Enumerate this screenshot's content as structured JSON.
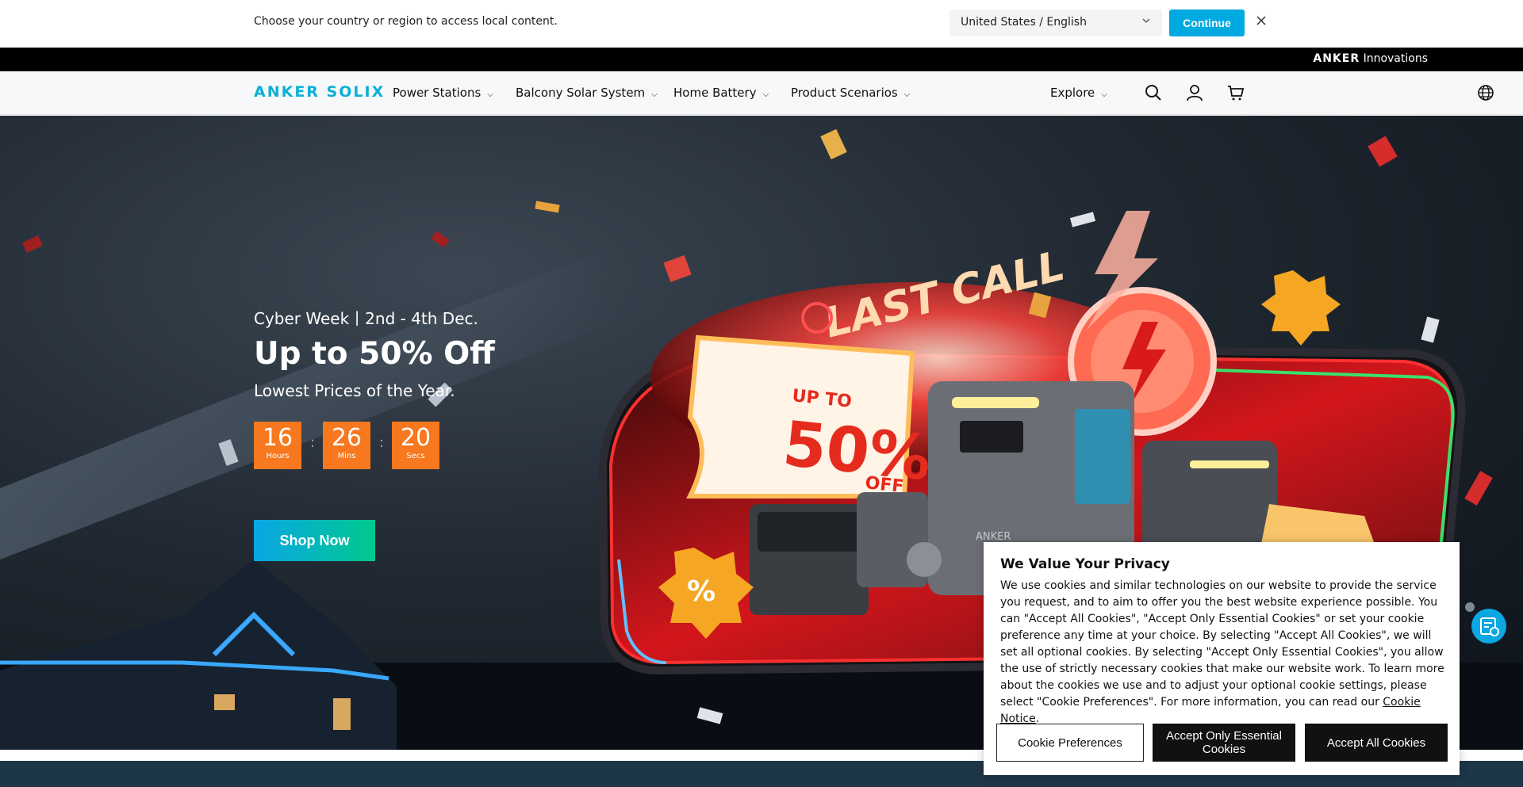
{
  "region_bar": {
    "message": "Choose your country or region to access local content.",
    "selected_region": "United States / English",
    "continue_label": "Continue",
    "close_icon": "close-icon"
  },
  "top_strip": {
    "brand_bold": "ANKER",
    "brand_rest": " Innovations"
  },
  "nav": {
    "logo": "ANKER SOLIX",
    "items": [
      {
        "label": "Power Stations"
      },
      {
        "label": "Balcony Solar System"
      },
      {
        "label": "Home Battery"
      },
      {
        "label": "Product Scenarios"
      }
    ],
    "explore_label": "Explore",
    "icons": [
      "search-icon",
      "user-icon",
      "cart-icon",
      "globe-icon"
    ]
  },
  "hero": {
    "subtitle": "Cyber Week丨2nd - 4th Dec.",
    "title": "Up to 50% Off",
    "description": "Lowest Prices of the Year.",
    "countdown": [
      {
        "value": "16",
        "label": "Hours"
      },
      {
        "value": "26",
        "label": "Mins"
      },
      {
        "value": "20",
        "label": "Secs"
      }
    ],
    "countdown_separator": ":",
    "shop_label": "Shop Now",
    "art": {
      "last_call": "LAST CALL",
      "up_to": "UP TO",
      "percent": "50%",
      "off": "OFF",
      "percent_sign": "%",
      "product_brand": "ANKER"
    }
  },
  "cookie": {
    "title": "We Value Your Privacy",
    "body": "We use cookies and similar technologies on our website to provide the service you request, and to aim to offer you the best website experience possible. You can \"Accept All Cookies\", \"Accept Only Essential Cookies\" or set your cookie preference any time at your choice. By selecting \"Accept All Cookies\", we will set all optional cookies. By selecting \"Accept Only Essential Cookies\", you allow the use of strictly necessary cookies that make our website work. To learn more about the cookies we use and to adjust your optional cookie settings, please select \"Cookie Preferences\". For more information, you can read our ",
    "link_label": "Cookie Notice",
    "link_suffix": ".",
    "preferences_label": "Cookie Preferences",
    "essential_label": "Accept Only Essential Cookies",
    "accept_all_label": "Accept All Cookies"
  },
  "colors": {
    "accent": "#00a9e0",
    "countdown": "#f7781e",
    "cookie_button": "#111111"
  }
}
